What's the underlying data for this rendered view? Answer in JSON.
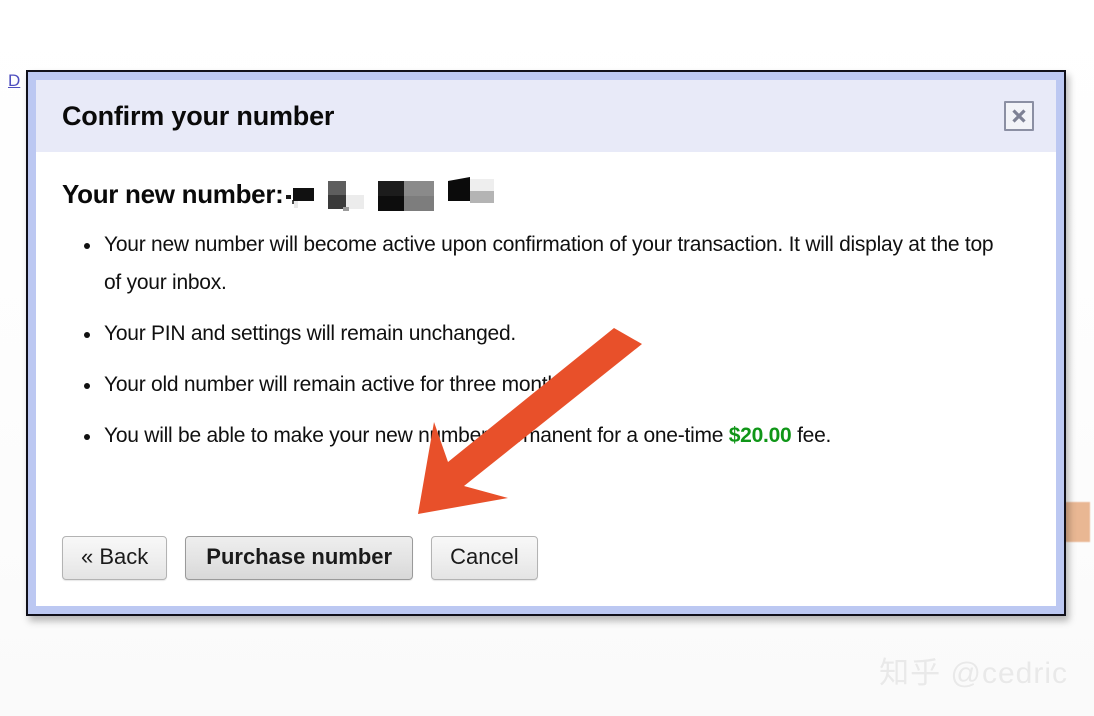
{
  "background": {
    "link_text": "D",
    "shape_name": "partial-orange-shape"
  },
  "dialog": {
    "title": "Confirm your number",
    "close_label": "×",
    "close_icon": "close-x-icon",
    "number_label": "Your new number:",
    "number_value_redacted": "███ ███ ████",
    "bullets": [
      "Your new number will become active upon confirmation of your transaction. It will display at the top of your inbox.",
      "Your PIN and settings will remain unchanged.",
      "Your old number will remain active for three months."
    ],
    "bullet_four": {
      "before": "You will be able to make your new number permanent for a one-time ",
      "price": "$20.00",
      "after": " fee."
    },
    "buttons": {
      "back": "« Back",
      "purchase": "Purchase number",
      "cancel": "Cancel"
    }
  },
  "annotation": {
    "arrow_name": "pointer-arrow-to-purchase-button",
    "arrow_color": "#E8502A",
    "points_at": "Purchase number"
  },
  "watermark": {
    "text": "知乎 @cedric"
  },
  "colors": {
    "dialog_border": "#bcc8f2",
    "dialog_outline": "#10101a",
    "header_bg": "#e8eaf8",
    "price_green": "#109618",
    "arrow_orange": "#E8502A",
    "link_blue": "#4f4fbf",
    "watermark_gray": "#e9e9e9"
  }
}
